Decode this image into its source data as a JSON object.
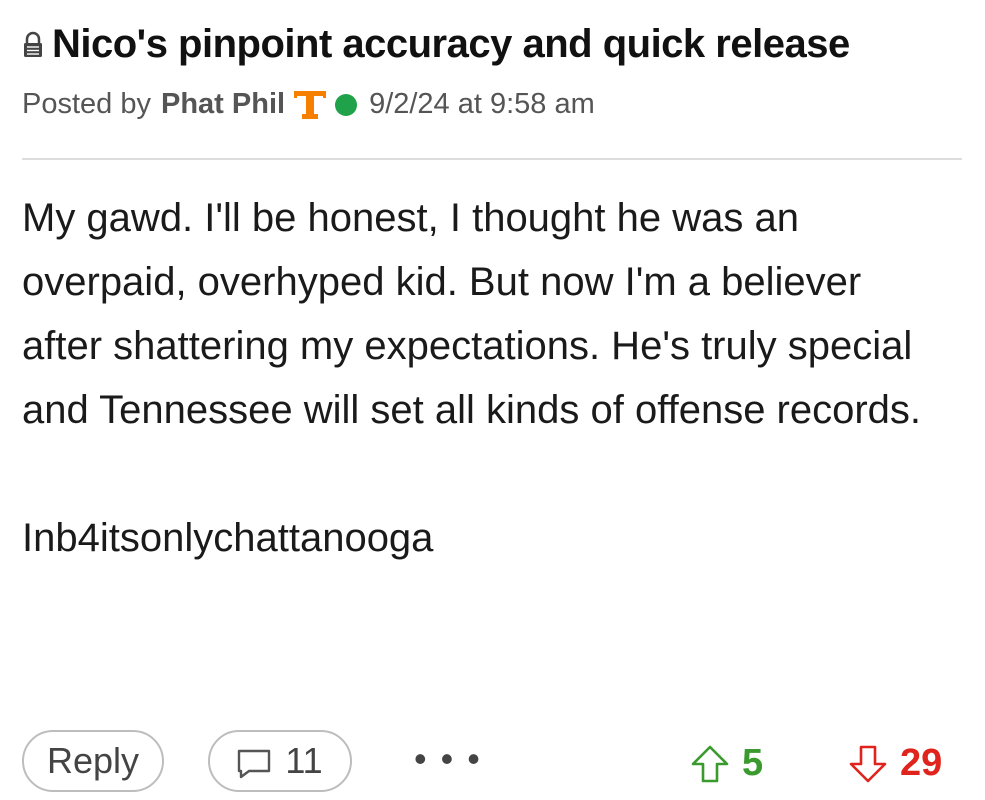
{
  "post": {
    "title": "Nico's pinpoint accuracy and quick release",
    "meta": {
      "posted_by_label": "Posted by",
      "author": "Phat Phil",
      "timestamp": "9/2/24 at 9:58 am",
      "team_logo_letter": "T"
    },
    "body": {
      "paragraph": "My gawd. I'll be honest, I thought he was an overpaid, overhyped kid. But now I'm a believer after shattering my expectations. He's truly special and Tennessee will set all kinds of offense records.",
      "signoff": "Inb4itsonlychattanooga"
    },
    "actions": {
      "reply_label": "Reply",
      "comment_count": "11",
      "more_label": "• • •",
      "upvotes": "5",
      "downvotes": "29"
    }
  },
  "colors": {
    "team_orange": "#f77f00",
    "online_green": "#1fa24a",
    "upvote_green": "#3a9a2e",
    "downvote_red": "#e0231c",
    "divider": "#dddddd"
  },
  "icons": {
    "lock": "lock-icon",
    "team_logo": "team-logo-icon",
    "online": "online-status-icon",
    "comment": "comment-icon",
    "upvote": "upvote-arrow-icon",
    "downvote": "downvote-arrow-icon"
  }
}
